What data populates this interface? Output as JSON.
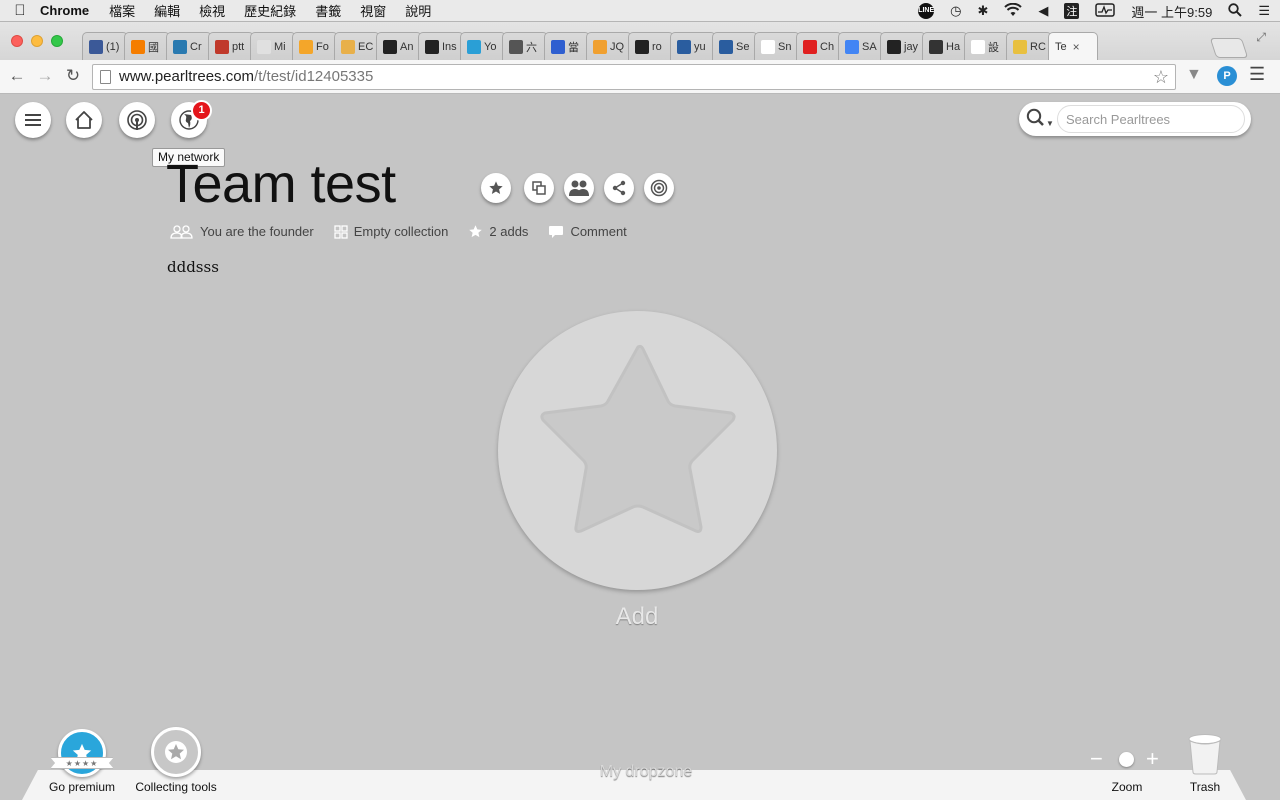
{
  "menubar": {
    "app_name": "Chrome",
    "items": [
      "檔案",
      "編輯",
      "檢視",
      "歷史紀錄",
      "書籤",
      "視窗",
      "說明"
    ],
    "clock": "週一 上午9:59",
    "ime_label": "注"
  },
  "tabs": [
    {
      "label": "(1)",
      "icon": "facebook-icon",
      "color": "#3b5998"
    },
    {
      "label": "國",
      "icon": "blogger-icon",
      "color": "#f57d00"
    },
    {
      "label": "Cr",
      "icon": "drop-icon",
      "color": "#2a7ab0"
    },
    {
      "label": "ptt",
      "icon": "ptt-icon",
      "color": "#c0392b"
    },
    {
      "label": "Mi",
      "icon": "circle-icon",
      "color": "#e0e0e0"
    },
    {
      "label": "Fo",
      "icon": "feedly-icon",
      "color": "#f4a62a"
    },
    {
      "label": "EC",
      "icon": "box-icon",
      "color": "#e8b04a"
    },
    {
      "label": "An",
      "icon": "amazon-icon",
      "color": "#222222"
    },
    {
      "label": "Ins",
      "icon": "github-icon",
      "color": "#222222"
    },
    {
      "label": "Yo",
      "icon": "feedly-icon",
      "color": "#2a9fd6"
    },
    {
      "label": "六",
      "icon": "m-icon",
      "color": "#555555"
    },
    {
      "label": "當",
      "icon": "chat-icon",
      "color": "#2f5fd0"
    },
    {
      "label": "JQ",
      "icon": "grid-icon",
      "color": "#f0a030"
    },
    {
      "label": "ro",
      "icon": "github-icon",
      "color": "#222222"
    },
    {
      "label": "yu",
      "icon": "shield-icon",
      "color": "#2a5d9f"
    },
    {
      "label": "Se",
      "icon": "x-icon",
      "color": "#2a5d9f"
    },
    {
      "label": "Sn",
      "icon": "page-icon",
      "color": "#ffffff"
    },
    {
      "label": "Ch",
      "icon": "chat-icon",
      "color": "#e02020"
    },
    {
      "label": "SA",
      "icon": "doc-icon",
      "color": "#4285f4"
    },
    {
      "label": "jay",
      "icon": "github-icon",
      "color": "#222222"
    },
    {
      "label": "Ha",
      "icon": "y-icon",
      "color": "#333333"
    },
    {
      "label": "設",
      "icon": "page-icon",
      "color": "#ffffff"
    },
    {
      "label": "RC",
      "icon": "r-icon",
      "color": "#e8c040"
    },
    {
      "label": "Te",
      "icon": "none",
      "color": "#f6f6f6",
      "active": true
    }
  ],
  "address": {
    "domain": "www.pearltrees.com",
    "path": "/t/test/id12405335"
  },
  "app": {
    "notification_count": "1",
    "tooltip": "My network",
    "search_placeholder": "Search Pearltrees",
    "title": "Team test",
    "meta": {
      "founder": "You are the founder",
      "collection": "Empty collection",
      "adds": "2 adds",
      "comment": "Comment"
    },
    "description": "dddsss",
    "add_label": "Add"
  },
  "bottom": {
    "premium_label": "Go premium",
    "tools_label": "Collecting tools",
    "dropzone_label": "My dropzone",
    "zoom_label": "Zoom",
    "trash_label": "Trash"
  },
  "colors": {
    "background": "#c5c5c5",
    "badge": "#e4151b",
    "premium": "#2aa6db"
  }
}
